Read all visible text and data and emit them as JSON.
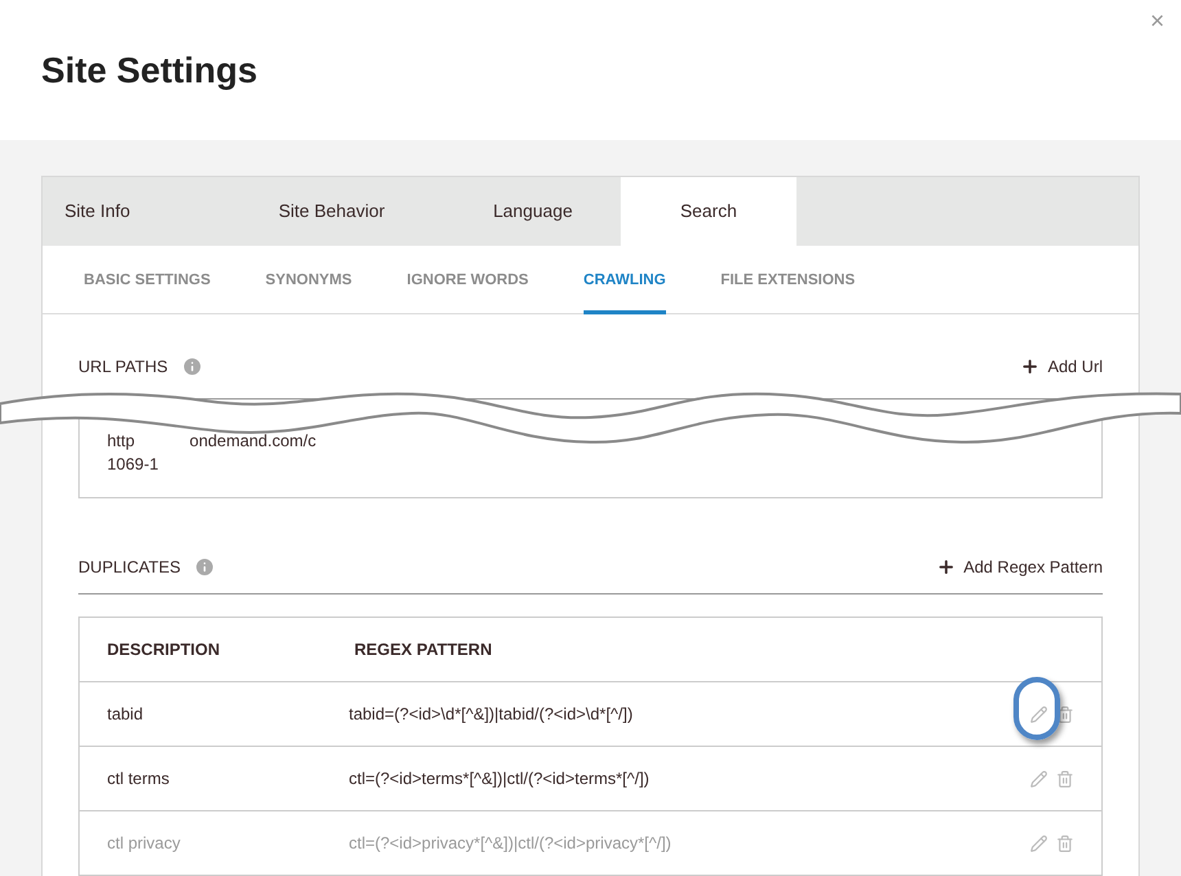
{
  "dialog": {
    "title": "Site Settings",
    "close": "×"
  },
  "tabs": [
    {
      "label": "Site Info",
      "selected": false
    },
    {
      "label": "Site Behavior",
      "selected": false
    },
    {
      "label": "Language",
      "selected": false
    },
    {
      "label": "Search",
      "selected": true
    }
  ],
  "subtabs": [
    {
      "label": "BASIC SETTINGS",
      "selected": false
    },
    {
      "label": "SYNONYMS",
      "selected": false
    },
    {
      "label": "IGNORE WORDS",
      "selected": false
    },
    {
      "label": "CRAWLING",
      "selected": true
    },
    {
      "label": "FILE EXTENSIONS",
      "selected": false
    }
  ],
  "url_paths": {
    "title": "URL PATHS",
    "add": "Add Url",
    "row": {
      "line_1a": "http",
      "line_1b": "ondemand.com/c",
      "line_2": "1069-1"
    }
  },
  "duplicates": {
    "title": "DUPLICATES",
    "add": "Add Regex Pattern",
    "columns": [
      "DESCRIPTION",
      "REGEX PATTERN"
    ],
    "rows": [
      {
        "description": "tabid",
        "pattern": "tabid=(?<id>\\d*[^&])|tabid/(?<id>\\d*[^/])",
        "highlighted": true,
        "dimmed": false
      },
      {
        "description": "ctl terms",
        "pattern": "ctl=(?<id>terms*[^&])|ctl/(?<id>terms*[^/])",
        "highlighted": false,
        "dimmed": false
      },
      {
        "description": "ctl privacy",
        "pattern": "ctl=(?<id>privacy*[^&])|ctl/(?<id>privacy*[^/])",
        "highlighted": false,
        "dimmed": true
      }
    ]
  }
}
